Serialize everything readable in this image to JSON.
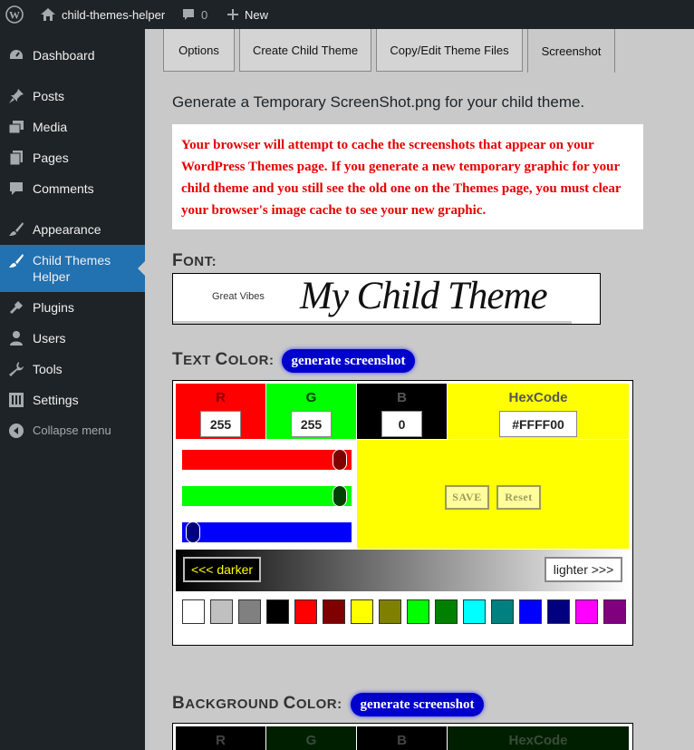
{
  "adminbar": {
    "site_name": "child-themes-helper",
    "comment_count": "0",
    "new_label": "New"
  },
  "sidebar": {
    "items": [
      {
        "label": "Dashboard",
        "icon": "dashboard-icon"
      },
      {
        "label": "Posts",
        "icon": "pin-icon"
      },
      {
        "label": "Media",
        "icon": "media-icon"
      },
      {
        "label": "Pages",
        "icon": "pages-icon"
      },
      {
        "label": "Comments",
        "icon": "comment-icon"
      },
      {
        "label": "Appearance",
        "icon": "brush-icon"
      },
      {
        "label": "Child Themes Helper",
        "icon": "brush-icon",
        "active": true
      },
      {
        "label": "Plugins",
        "icon": "plug-icon"
      },
      {
        "label": "Users",
        "icon": "user-icon"
      },
      {
        "label": "Tools",
        "icon": "wrench-icon"
      },
      {
        "label": "Settings",
        "icon": "settings-icon"
      },
      {
        "label": "Collapse menu",
        "icon": "collapse-icon"
      }
    ]
  },
  "tabs": [
    "Options",
    "Create Child Theme",
    "Copy/Edit Theme Files",
    "Screenshot"
  ],
  "active_tab": "Screenshot",
  "main": {
    "heading": "Generate a Temporary ScreenShot.png for your child theme.",
    "notice": "Your browser will attempt to cache the screenshots that appear on your WordPress Themes page. If you generate a new temporary graphic for your child theme and you still see the old one on the Themes page, you must clear your browser's image cache to see your new graphic.",
    "font_label_first": "F",
    "font_label_rest": "ONT:",
    "font_name": "Great Vibes",
    "font_preview": "My Child Theme",
    "text_color_first": "T",
    "text_color_rest_1": "EXT ",
    "text_color_first_2": "C",
    "text_color_rest_2": "OLOR:",
    "generate_label": "generate screenshot",
    "bg_color_first": "B",
    "bg_color_rest_1": "ACKGROUND ",
    "bg_color_first_2": "C",
    "bg_color_rest_2": "OLOR:"
  },
  "text_color_picker": {
    "r_label": "R",
    "g_label": "G",
    "b_label": "B",
    "hex_label": "HexCode",
    "r": "255",
    "g": "255",
    "b": "0",
    "hex": "#FFFF00",
    "r_level": 1.0,
    "g_level": 1.0,
    "b_level": 0.0,
    "save_label": "SAVE",
    "reset_label": "Reset",
    "darker_label": "<<< darker",
    "lighter_label": "lighter >>>",
    "swatches": [
      "#ffffff",
      "#c0c0c0",
      "#808080",
      "#000000",
      "#ff0000",
      "#800000",
      "#ffff00",
      "#808000",
      "#00ff00",
      "#008000",
      "#00ffff",
      "#008080",
      "#0000ff",
      "#000080",
      "#ff00ff",
      "#800080"
    ]
  },
  "bg_color_picker": {
    "r_label": "R",
    "g_label": "G",
    "b_label": "B",
    "hex_label": "HexCode"
  },
  "colors": {
    "admin_dark": "#1d2327",
    "active_blue": "#2271b1",
    "notice_red": "#e60000",
    "generate_button": "#0000cc",
    "selected_color": "#ffff00"
  }
}
